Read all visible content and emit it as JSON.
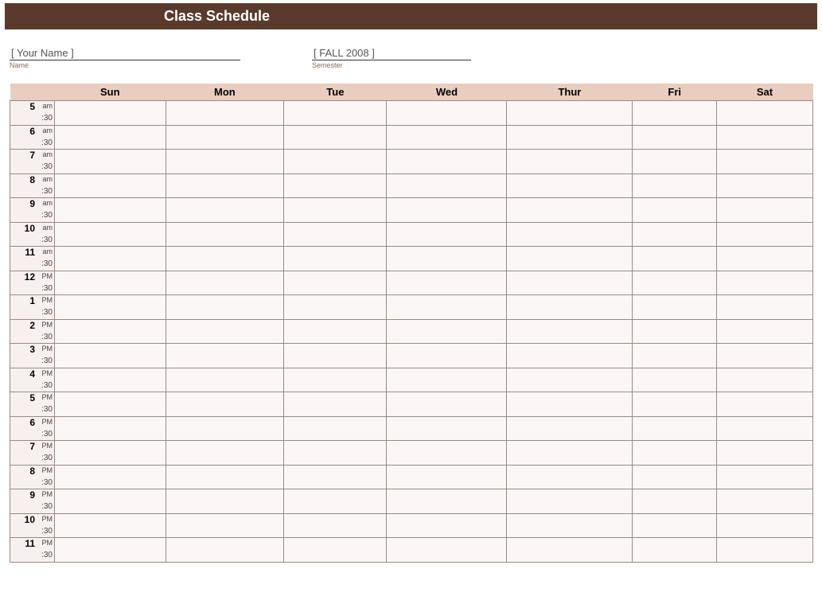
{
  "header": {
    "title": "Class Schedule"
  },
  "meta": {
    "name": {
      "value": "[  Your Name ]",
      "label": "Name"
    },
    "semester": {
      "value": "[ FALL 2008 ]",
      "label": "Semester"
    }
  },
  "days": [
    "Sun",
    "Mon",
    "Tue",
    "Wed",
    "Thur",
    "Fri",
    "Sat"
  ],
  "half_label": ":30",
  "time_header": "",
  "hours": [
    {
      "num": "5",
      "suffix": "am"
    },
    {
      "num": "6",
      "suffix": "am"
    },
    {
      "num": "7",
      "suffix": "am"
    },
    {
      "num": "8",
      "suffix": "am"
    },
    {
      "num": "9",
      "suffix": "am"
    },
    {
      "num": "10",
      "suffix": "am"
    },
    {
      "num": "11",
      "suffix": "am"
    },
    {
      "num": "12",
      "suffix": "PM"
    },
    {
      "num": "1",
      "suffix": "PM"
    },
    {
      "num": "2",
      "suffix": "PM"
    },
    {
      "num": "3",
      "suffix": "PM"
    },
    {
      "num": "4",
      "suffix": "PM"
    },
    {
      "num": "5",
      "suffix": "PM"
    },
    {
      "num": "6",
      "suffix": "PM"
    },
    {
      "num": "7",
      "suffix": "PM"
    },
    {
      "num": "8",
      "suffix": "PM"
    },
    {
      "num": "9",
      "suffix": "PM"
    },
    {
      "num": "10",
      "suffix": "PM"
    },
    {
      "num": "11",
      "suffix": "PM"
    }
  ]
}
